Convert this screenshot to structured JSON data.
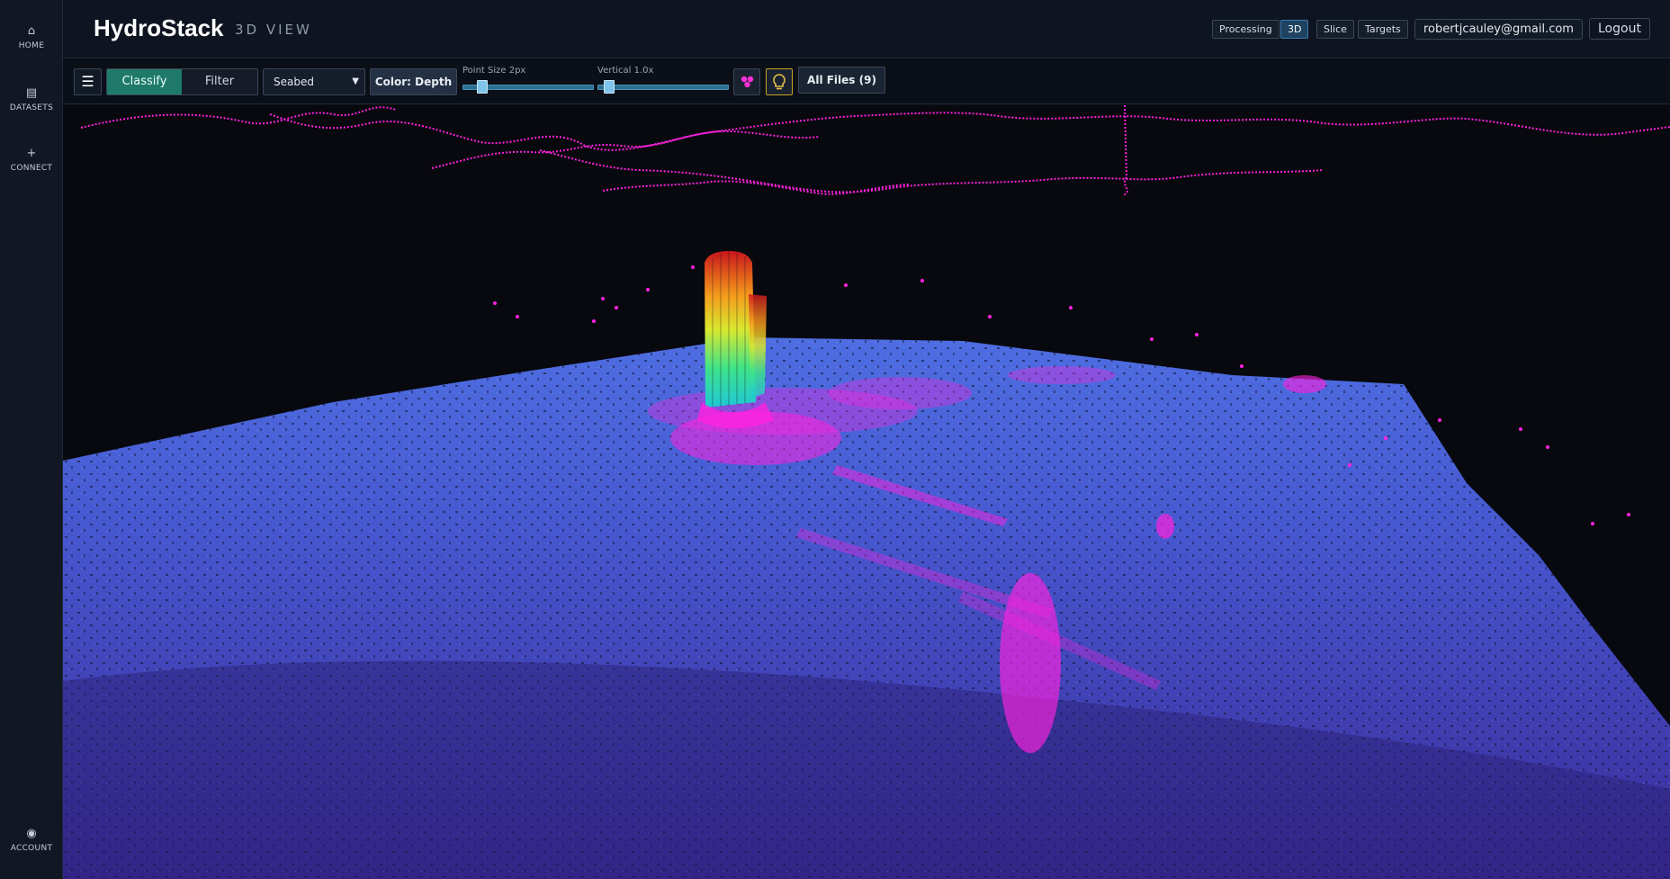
{
  "sidebar": {
    "items": [
      {
        "icon": "home-icon",
        "glyph": "⌂",
        "label": "HOME"
      },
      {
        "icon": "datasets-icon",
        "glyph": "▤",
        "label": "DATASETS"
      },
      {
        "icon": "plus-icon",
        "glyph": "+",
        "label": "CONNECT"
      },
      {
        "icon": "account-icon",
        "glyph": "◉",
        "label": "ACCOUNT"
      }
    ]
  },
  "header": {
    "title": "HydroStack",
    "subtitle": "3D VIEW",
    "nav": {
      "processing": "Processing",
      "view3d": "3D",
      "slice": "Slice",
      "targets": "Targets"
    },
    "active_nav": "3D",
    "user_email": "robertjcauley@gmail.com",
    "logout_label": "Logout"
  },
  "toolbar": {
    "menu_glyph": "☰",
    "mode_options": [
      "Classify",
      "Filter"
    ],
    "active_mode": "Classify",
    "layer_select": {
      "value": "Seabed"
    },
    "color_label": "Color: Depth",
    "point_size": {
      "label": "Point Size 2px",
      "value": 2
    },
    "vertical": {
      "label": "Vertical 1.0x",
      "value": 1.0
    },
    "files_label": "All Files (9)"
  },
  "colors": {
    "accent": "#1f7a6a",
    "active_nav": "#1e4260",
    "magenta_points": "#ff1fe0",
    "seabed_top": "#4b62d6",
    "seabed_bottom": "#3a2f9e",
    "highlight_border": "#c9a227"
  }
}
